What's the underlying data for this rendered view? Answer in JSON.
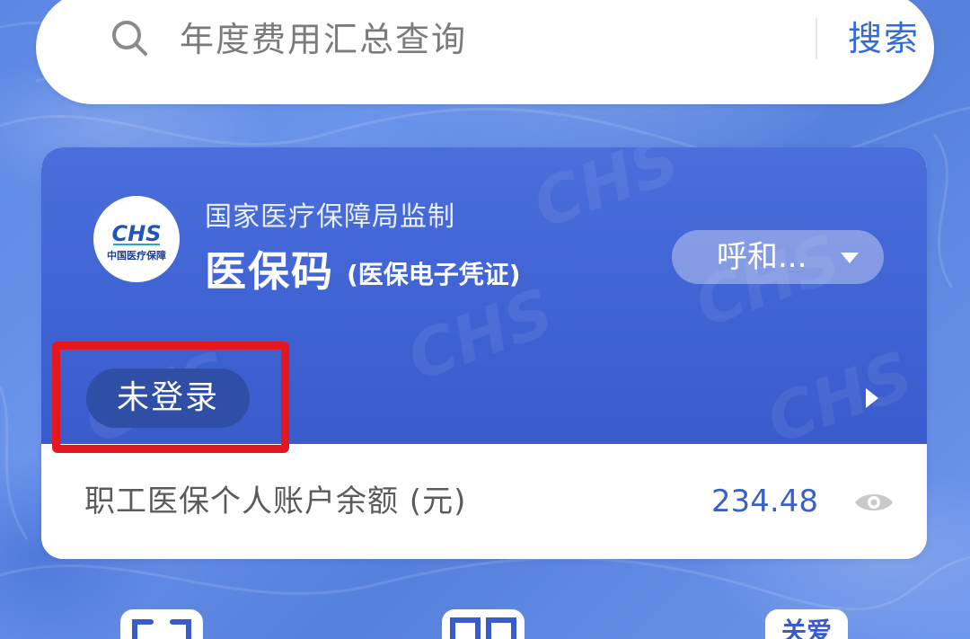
{
  "search": {
    "placeholder": "年度费用汇总查询",
    "button_label": "搜索",
    "icon": "search-icon"
  },
  "card": {
    "logo_text": "中国医疗保障",
    "supervisor": "国家医疗保障局监制",
    "title": "医保码",
    "subtitle": "(医保电子凭证)",
    "region": "呼和...",
    "login_status": "未登录",
    "balance_label": "职工医保个人账户余额 (元)",
    "balance_value": "234.48"
  },
  "bottom_icons": {
    "care_label": "关爱"
  },
  "colors": {
    "brand_blue": "#3f62d3",
    "link_blue": "#2f6bdc",
    "highlight_red": "#e5161e",
    "background_blue": "#5b86e3"
  }
}
